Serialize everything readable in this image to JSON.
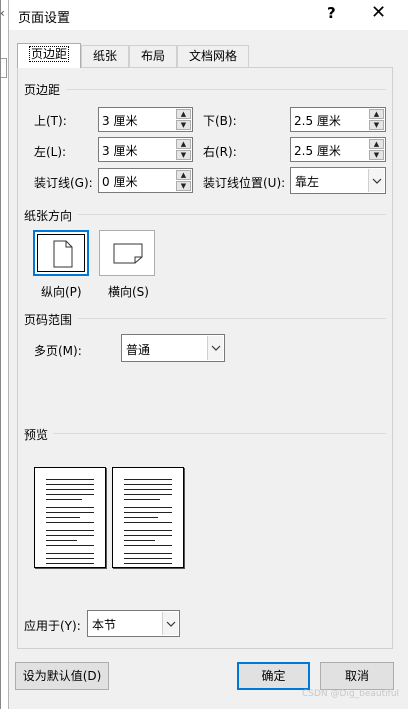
{
  "window": {
    "title": "页面设置",
    "help": "?",
    "close": "✕"
  },
  "tabs": [
    "页边距",
    "纸张",
    "布局",
    "文档网格"
  ],
  "margins": {
    "heading": "页边距",
    "top_label": "上(T):",
    "top_value": "3 厘米",
    "bottom_label": "下(B):",
    "bottom_value": "2.5 厘米",
    "left_label": "左(L):",
    "left_value": "3 厘米",
    "right_label": "右(R):",
    "right_value": "2.5 厘米",
    "gutter_label": "装订线(G):",
    "gutter_value": "0 厘米",
    "gutter_pos_label": "装订线位置(U):",
    "gutter_pos_value": "靠左"
  },
  "orientation": {
    "heading": "纸张方向",
    "portrait": "纵向(P)",
    "landscape": "横向(S)"
  },
  "pages": {
    "heading": "页码范围",
    "multiple_label": "多页(M):",
    "multiple_value": "普通"
  },
  "preview": {
    "heading": "预览",
    "apply_label": "应用于(Y):",
    "apply_value": "本节"
  },
  "buttons": {
    "default": "设为默认值(D)",
    "ok": "确定",
    "cancel": "取消"
  },
  "watermark": "CSDN @Dig_beautiful",
  "colors": {
    "accent": "#0078d7"
  }
}
